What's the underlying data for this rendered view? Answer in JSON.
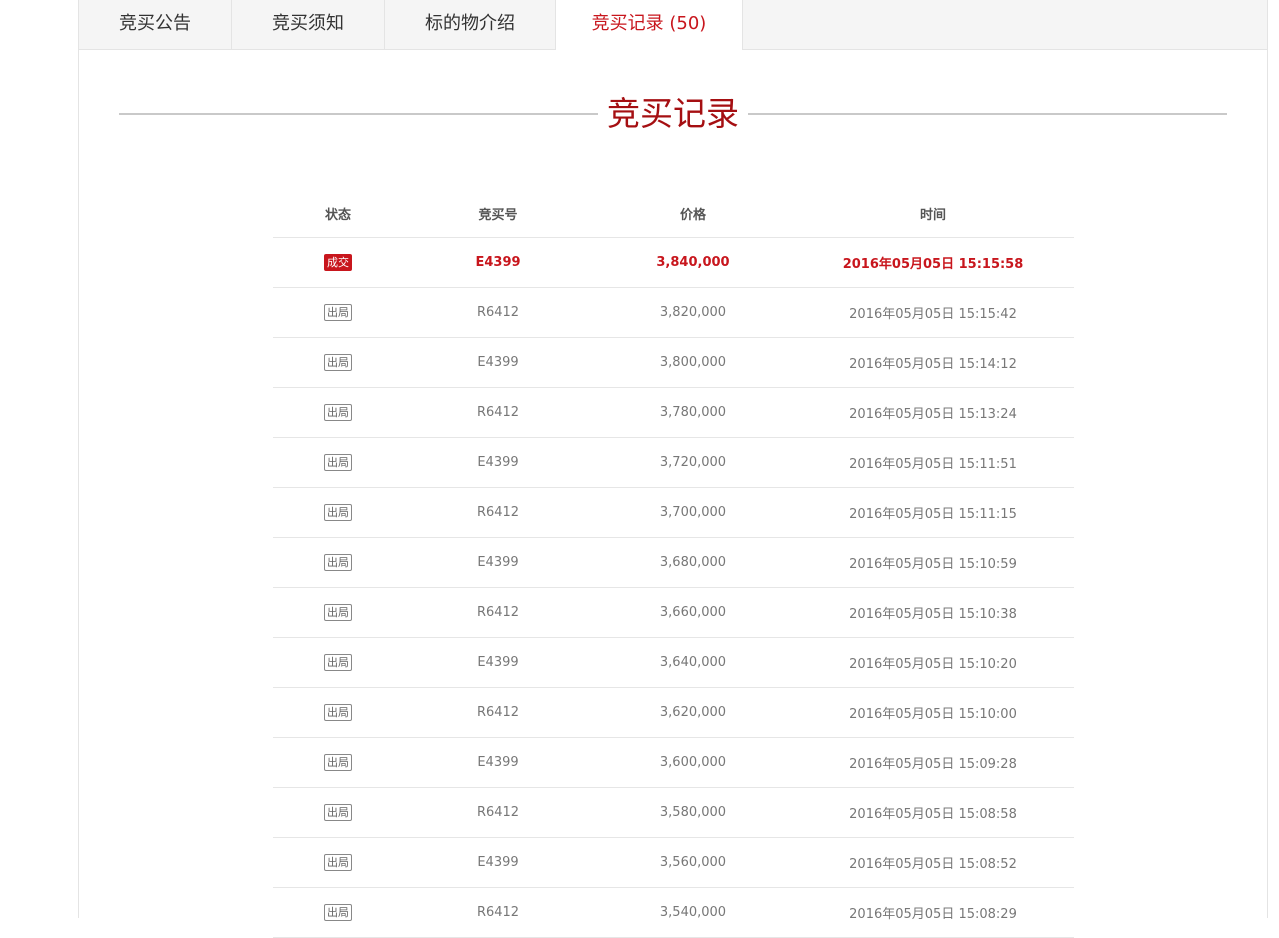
{
  "tabs": [
    {
      "label": "竞买公告"
    },
    {
      "label": "竞买须知"
    },
    {
      "label": "标的物介绍"
    },
    {
      "label": "竞买记录 (50)"
    }
  ],
  "active_tab_index": 3,
  "section_title": "竞买记录",
  "colors": {
    "accent": "#c8161d",
    "title": "#a50f12",
    "tab_bg": "#f5f5f5"
  },
  "table": {
    "headers": [
      "状态",
      "竞买号",
      "价格",
      "时间"
    ],
    "rows": [
      {
        "status": "成交",
        "bidder": "E4399",
        "price": "3,840,000",
        "time": "2016年05月05日 15:15:58"
      },
      {
        "status": "出局",
        "bidder": "R6412",
        "price": "3,820,000",
        "time": "2016年05月05日 15:15:42"
      },
      {
        "status": "出局",
        "bidder": "E4399",
        "price": "3,800,000",
        "time": "2016年05月05日 15:14:12"
      },
      {
        "status": "出局",
        "bidder": "R6412",
        "price": "3,780,000",
        "time": "2016年05月05日 15:13:24"
      },
      {
        "status": "出局",
        "bidder": "E4399",
        "price": "3,720,000",
        "time": "2016年05月05日 15:11:51"
      },
      {
        "status": "出局",
        "bidder": "R6412",
        "price": "3,700,000",
        "time": "2016年05月05日 15:11:15"
      },
      {
        "status": "出局",
        "bidder": "E4399",
        "price": "3,680,000",
        "time": "2016年05月05日 15:10:59"
      },
      {
        "status": "出局",
        "bidder": "R6412",
        "price": "3,660,000",
        "time": "2016年05月05日 15:10:38"
      },
      {
        "status": "出局",
        "bidder": "E4399",
        "price": "3,640,000",
        "time": "2016年05月05日 15:10:20"
      },
      {
        "status": "出局",
        "bidder": "R6412",
        "price": "3,620,000",
        "time": "2016年05月05日 15:10:00"
      },
      {
        "status": "出局",
        "bidder": "E4399",
        "price": "3,600,000",
        "time": "2016年05月05日 15:09:28"
      },
      {
        "status": "出局",
        "bidder": "R6412",
        "price": "3,580,000",
        "time": "2016年05月05日 15:08:58"
      },
      {
        "status": "出局",
        "bidder": "E4399",
        "price": "3,560,000",
        "time": "2016年05月05日 15:08:52"
      },
      {
        "status": "出局",
        "bidder": "R6412",
        "price": "3,540,000",
        "time": "2016年05月05日 15:08:29"
      }
    ]
  }
}
